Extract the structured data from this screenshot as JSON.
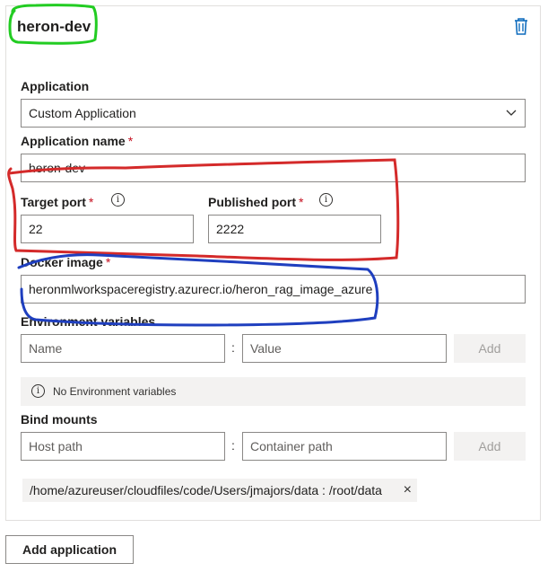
{
  "card": {
    "title": "heron-dev",
    "icons": {
      "delete": "trash-icon",
      "dropdown": "chevron-down-icon",
      "info": "info-icon",
      "remove": "close-icon"
    }
  },
  "application": {
    "label": "Application",
    "value": "Custom Application"
  },
  "application_name": {
    "label": "Application name",
    "required": "*",
    "value": "heron-dev"
  },
  "target_port": {
    "label": "Target port",
    "required": "*",
    "info_glyph": "i",
    "value": "22"
  },
  "published_port": {
    "label": "Published port",
    "required": "*",
    "info_glyph": "i",
    "value": "2222"
  },
  "docker_image": {
    "label": "Docker image",
    "required": "*",
    "value": "heronmlworkspaceregistry.azurecr.io/heron_rag_image_azure"
  },
  "env_vars": {
    "label": "Environment variables",
    "name_placeholder": "Name",
    "value_placeholder": "Value",
    "separator": ":",
    "add_label": "Add",
    "empty_message": "No Environment variables",
    "info_glyph": "i"
  },
  "bind_mounts": {
    "label": "Bind mounts",
    "host_placeholder": "Host path",
    "container_placeholder": "Container path",
    "separator": ":",
    "add_label": "Add",
    "mounts": [
      {
        "text": "/home/azureuser/cloudfiles/code/Users/jmajors/data : /root/data",
        "remove": "×"
      }
    ]
  },
  "add_application_label": "Add application",
  "annotations": {
    "green": "#22cc22",
    "red": "#d42a2a",
    "blue": "#1f3fbf"
  },
  "accent_required": "#c50f1f"
}
